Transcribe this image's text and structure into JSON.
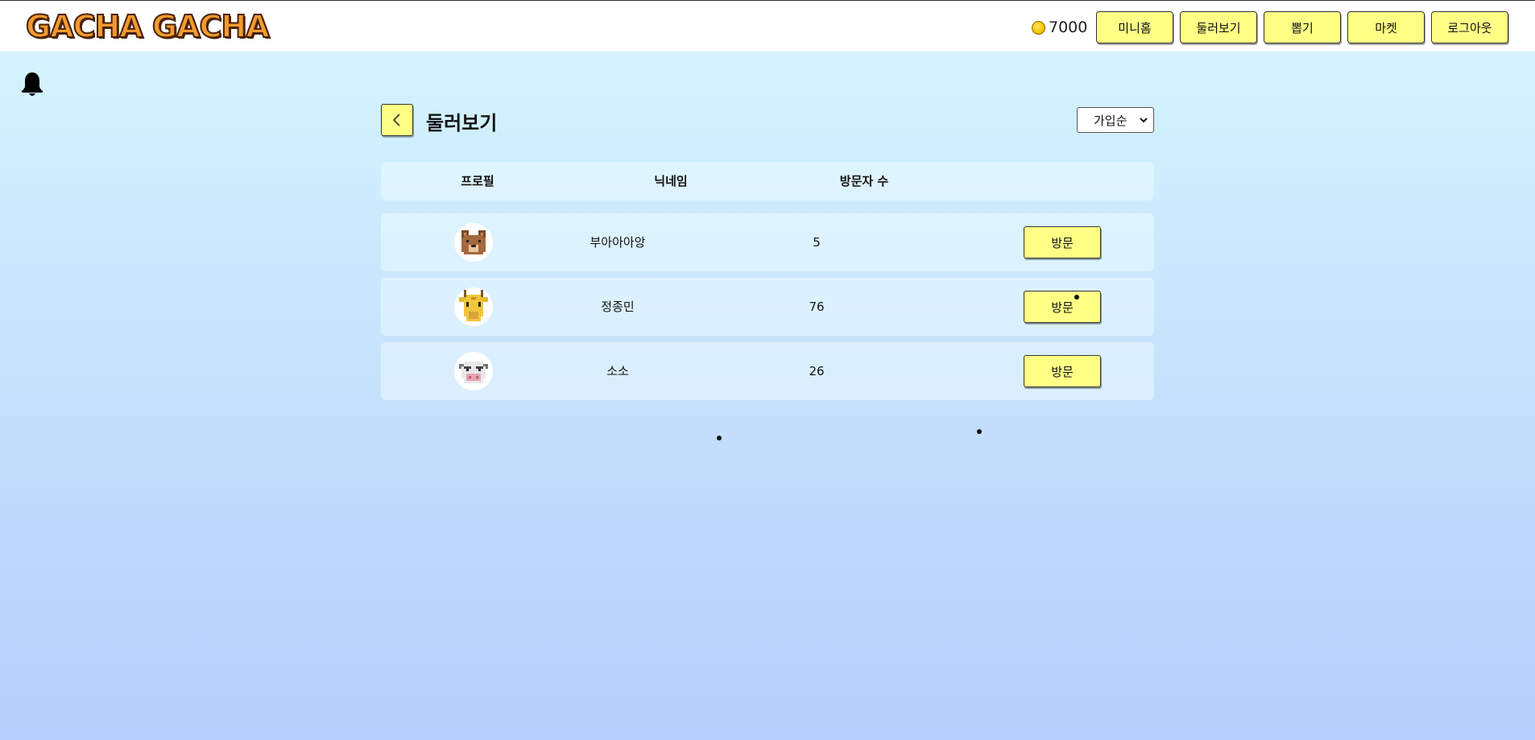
{
  "header": {
    "logo_text": "GACHA GACHA",
    "coin_amount": "7000",
    "nav": [
      "미니홈",
      "둘러보기",
      "뽑기",
      "마켓",
      "로그아웃"
    ]
  },
  "page": {
    "title": "둘러보기",
    "sort_selected": "가입순"
  },
  "table": {
    "columns": [
      "프로필",
      "닉네임",
      "방문자 수"
    ],
    "rows": [
      {
        "avatar": "bear-avatar-icon",
        "nickname": "부아아아앙",
        "visitors": "5",
        "action": "방문"
      },
      {
        "avatar": "giraffe-avatar-icon",
        "nickname": "정종민",
        "visitors": "76",
        "action": "방문"
      },
      {
        "avatar": "cow-avatar-icon",
        "nickname": "소소",
        "visitors": "26",
        "action": "방문"
      }
    ]
  },
  "colors": {
    "button_yellow": "#ffff86",
    "bg_top": "#d6f7ff",
    "bg_bottom": "#b7cdfb"
  },
  "icons": {
    "coin": "coin-icon",
    "bell": "bell-icon",
    "back": "chevron-left-icon",
    "sort": "chevron-down-icon"
  }
}
